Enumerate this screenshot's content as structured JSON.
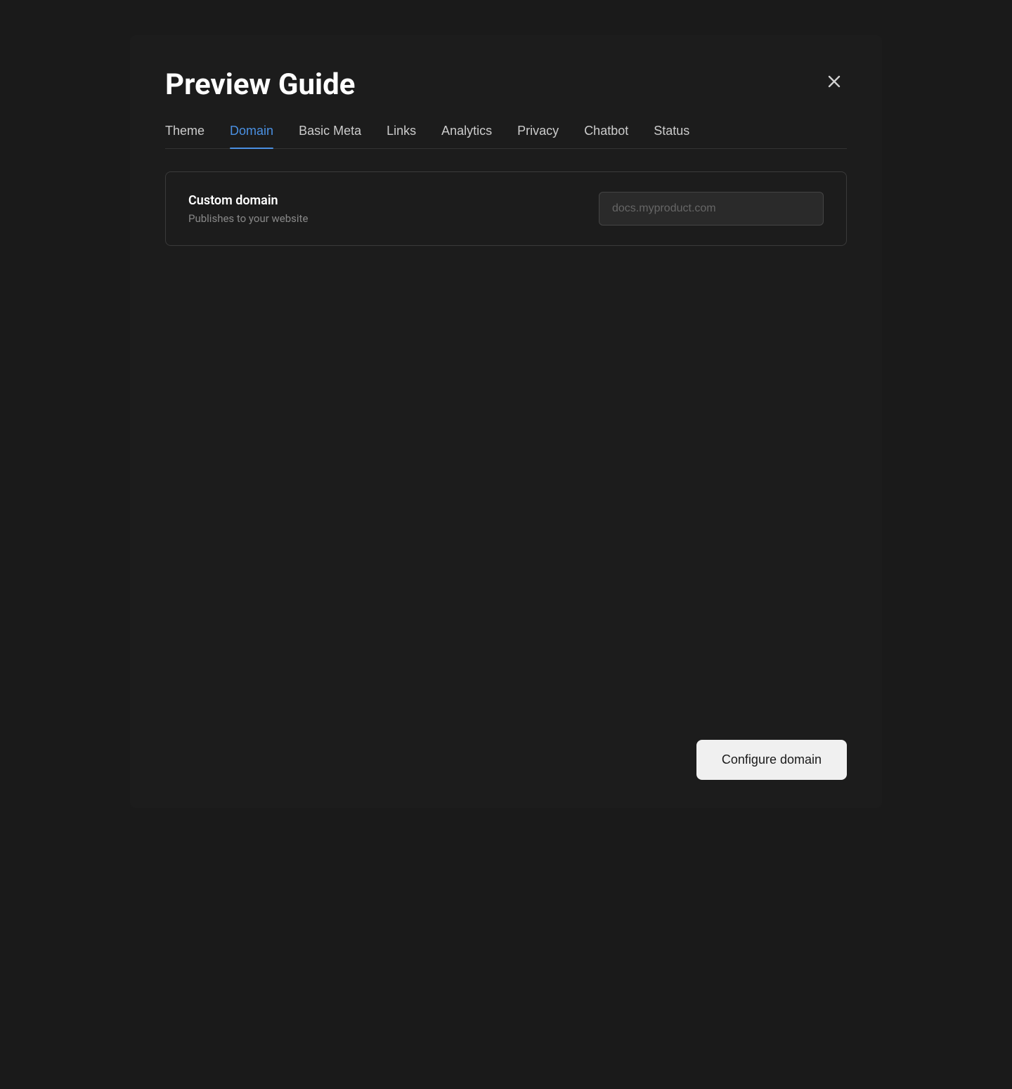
{
  "modal": {
    "title": "Preview Guide",
    "close_label": "×"
  },
  "nav": {
    "tabs": [
      {
        "id": "theme",
        "label": "Theme",
        "active": false
      },
      {
        "id": "domain",
        "label": "Domain",
        "active": true
      },
      {
        "id": "basic-meta",
        "label": "Basic Meta",
        "active": false
      },
      {
        "id": "links",
        "label": "Links",
        "active": false
      },
      {
        "id": "analytics",
        "label": "Analytics",
        "active": false
      },
      {
        "id": "privacy",
        "label": "Privacy",
        "active": false
      },
      {
        "id": "chatbot",
        "label": "Chatbot",
        "active": false
      },
      {
        "id": "status",
        "label": "Status",
        "active": false
      }
    ]
  },
  "content": {
    "domain": {
      "card": {
        "title": "Custom domain",
        "subtitle": "Publishes to your website",
        "input_placeholder": "docs.myproduct.com"
      }
    }
  },
  "footer": {
    "configure_button_label": "Configure domain"
  },
  "colors": {
    "active_tab": "#4a90e2",
    "background": "#1c1c1c",
    "card_border": "#3a3a3a"
  }
}
